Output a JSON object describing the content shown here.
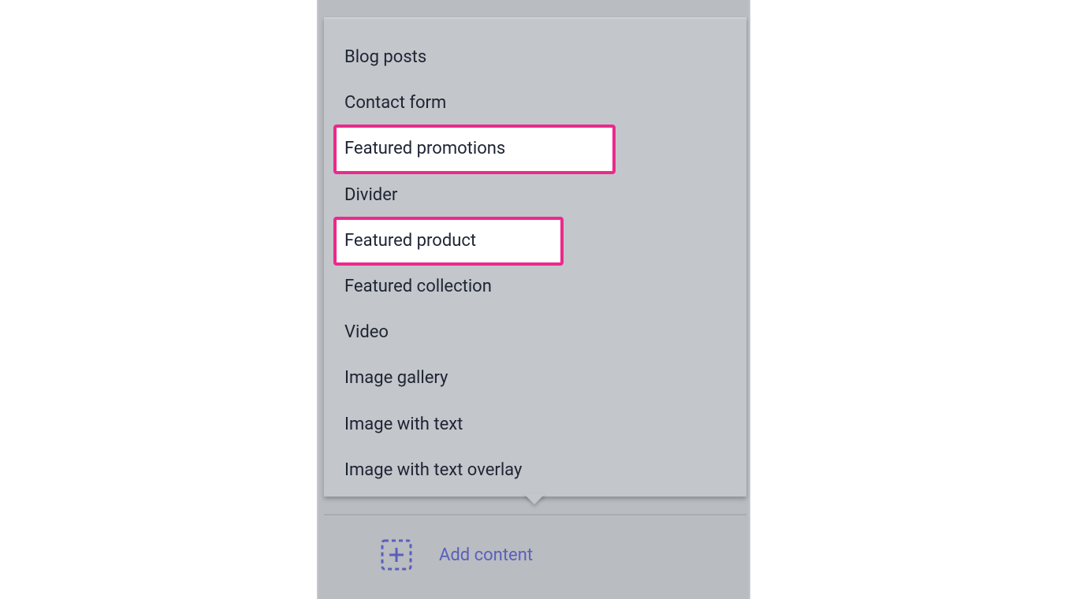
{
  "menu": {
    "items": [
      {
        "label": "Blog posts",
        "highlighted": false
      },
      {
        "label": "Contact form",
        "highlighted": false
      },
      {
        "label": "Featured promotions",
        "highlighted": true,
        "wide": true
      },
      {
        "label": "Divider",
        "highlighted": false
      },
      {
        "label": "Featured product",
        "highlighted": true,
        "wide": false
      },
      {
        "label": "Featured collection",
        "highlighted": false
      },
      {
        "label": "Video",
        "highlighted": false
      },
      {
        "label": "Image gallery",
        "highlighted": false
      },
      {
        "label": "Image with text",
        "highlighted": false
      },
      {
        "label": "Image with text overlay",
        "highlighted": false
      }
    ]
  },
  "footer": {
    "add_label": "Add content"
  },
  "colors": {
    "highlight_border": "#ec298c",
    "link": "#5a5fbc",
    "text": "#1d2433",
    "panel_bg": "#b9bcc0",
    "popover_bg": "#c3c6ca"
  }
}
